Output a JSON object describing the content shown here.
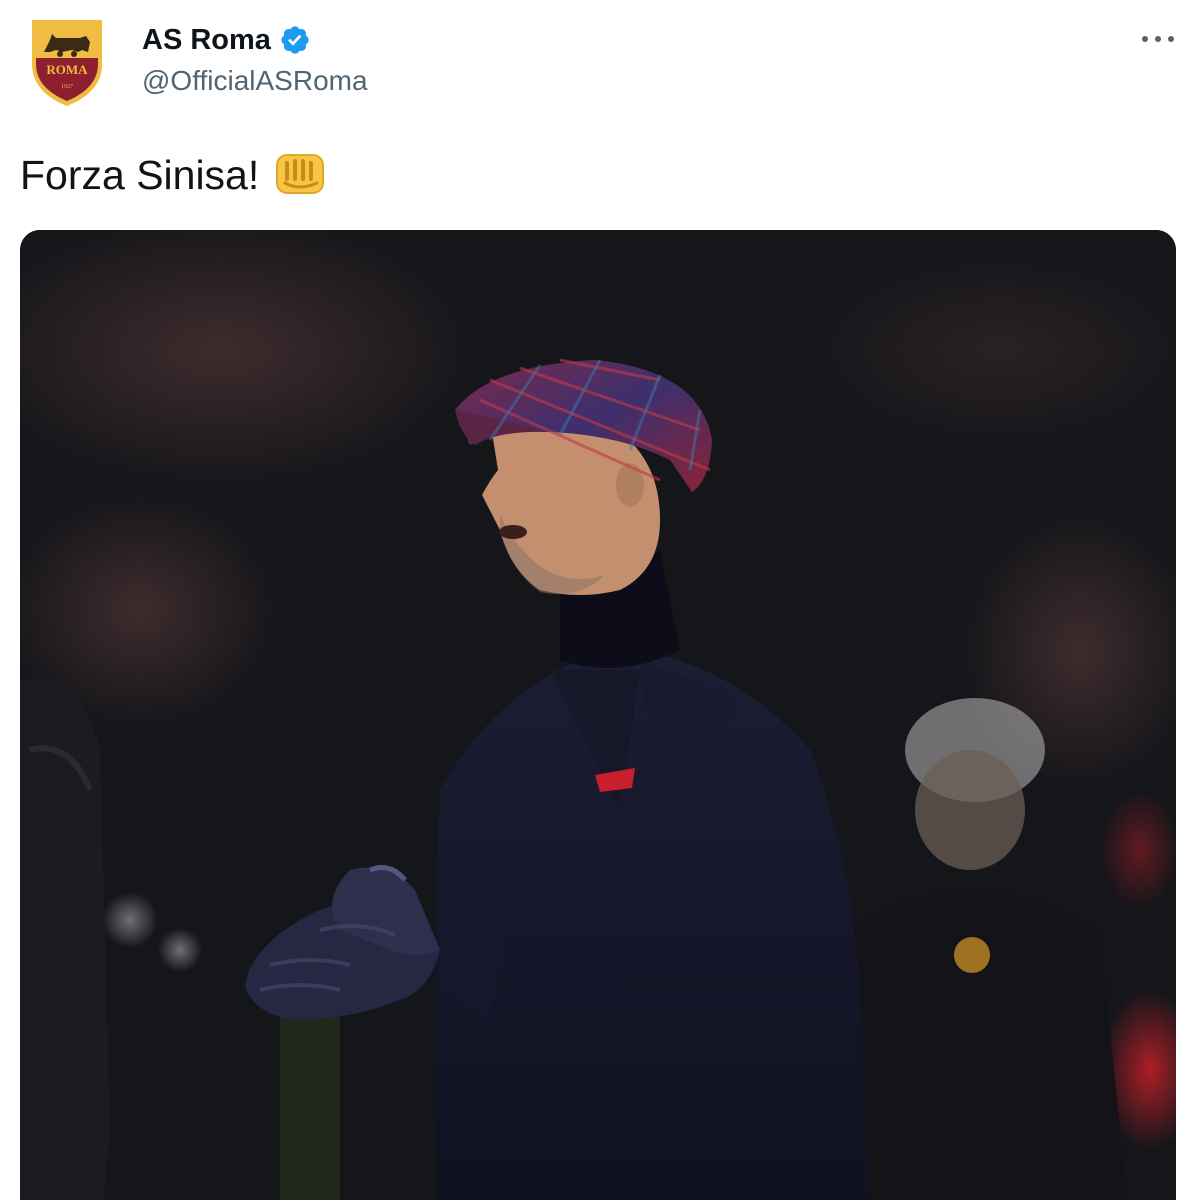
{
  "author": {
    "display_name": "AS Roma",
    "handle": "@OfficialASRoma",
    "avatar_icon": "as-roma-crest-icon",
    "avatar_text": "ROMA",
    "avatar_year": "1927",
    "verified": true,
    "verified_icon": "verified-badge-icon"
  },
  "tweet": {
    "text": "Forza Sinisa!",
    "emoji_icon": "oncoming-fist-icon"
  },
  "menu": {
    "icon": "more-options-icon"
  },
  "media": {
    "type": "photo",
    "subject": "coach-photo"
  },
  "colors": {
    "roma_red": "#8e1f2f",
    "roma_gold": "#f0bc42",
    "verified_blue": "#1d9bf0",
    "text_primary": "#0f1419",
    "text_secondary": "#536471"
  }
}
